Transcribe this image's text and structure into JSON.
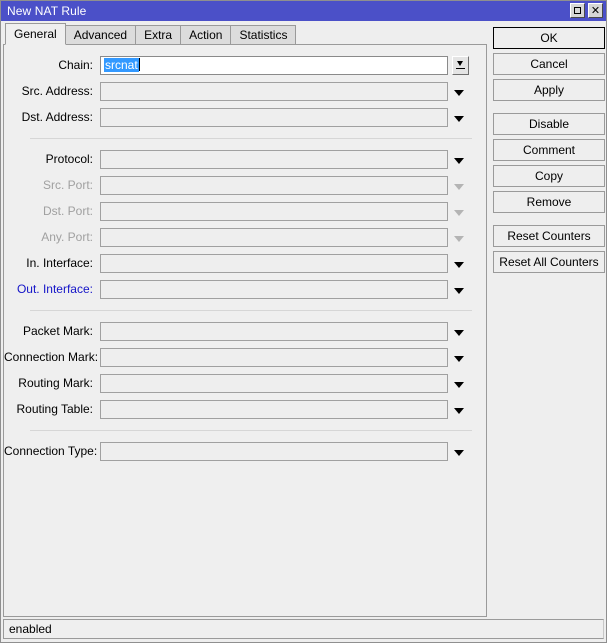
{
  "window": {
    "title": "New NAT Rule",
    "titlebar_color": "#4b50c8",
    "maximize_label": "▭",
    "close_label": "✕"
  },
  "tabs": [
    {
      "label": "General",
      "active": true
    },
    {
      "label": "Advanced",
      "active": false
    },
    {
      "label": "Extra",
      "active": false
    },
    {
      "label": "Action",
      "active": false
    },
    {
      "label": "Statistics",
      "active": false
    }
  ],
  "form": {
    "groups": [
      {
        "fields": [
          {
            "label": "Chain:",
            "value": "srcnat",
            "selected": true,
            "state": "focused",
            "control": "combo-button"
          },
          {
            "label": "Src. Address:",
            "value": "",
            "state": "enabled",
            "control": "arrow"
          },
          {
            "label": "Dst. Address:",
            "value": "",
            "state": "enabled",
            "control": "arrow"
          }
        ]
      },
      {
        "fields": [
          {
            "label": "Protocol:",
            "value": "",
            "state": "enabled",
            "control": "arrow"
          },
          {
            "label": "Src. Port:",
            "value": "",
            "state": "disabled",
            "control": "arrow"
          },
          {
            "label": "Dst. Port:",
            "value": "",
            "state": "disabled",
            "control": "arrow"
          },
          {
            "label": "Any. Port:",
            "value": "",
            "state": "disabled",
            "control": "arrow"
          },
          {
            "label": "In. Interface:",
            "value": "",
            "state": "enabled",
            "control": "arrow"
          },
          {
            "label": "Out. Interface:",
            "value": "",
            "state": "highlighted",
            "control": "arrow"
          }
        ]
      },
      {
        "fields": [
          {
            "label": "Packet Mark:",
            "value": "",
            "state": "enabled",
            "control": "arrow"
          },
          {
            "label": "Connection Mark:",
            "value": "",
            "state": "enabled",
            "control": "arrow"
          },
          {
            "label": "Routing Mark:",
            "value": "",
            "state": "enabled",
            "control": "arrow"
          },
          {
            "label": "Routing Table:",
            "value": "",
            "state": "enabled",
            "control": "arrow"
          }
        ]
      },
      {
        "fields": [
          {
            "label": "Connection Type:",
            "value": "",
            "state": "enabled",
            "control": "arrow"
          }
        ]
      }
    ]
  },
  "buttons": [
    {
      "label": "OK",
      "default": true,
      "gap_after": false
    },
    {
      "label": "Cancel",
      "default": false,
      "gap_after": false
    },
    {
      "label": "Apply",
      "default": false,
      "gap_after": true
    },
    {
      "label": "Disable",
      "default": false,
      "gap_after": false
    },
    {
      "label": "Comment",
      "default": false,
      "gap_after": false
    },
    {
      "label": "Copy",
      "default": false,
      "gap_after": false
    },
    {
      "label": "Remove",
      "default": false,
      "gap_after": true
    },
    {
      "label": "Reset Counters",
      "default": false,
      "gap_after": false
    },
    {
      "label": "Reset All Counters",
      "default": false,
      "gap_after": false
    }
  ],
  "statusbar": {
    "text": "enabled"
  },
  "colors": {
    "title_bar": "#4b50c8",
    "selection": "#3399ff",
    "highlight_label": "#1414c8",
    "disabled_label": "#a0a0a0"
  }
}
